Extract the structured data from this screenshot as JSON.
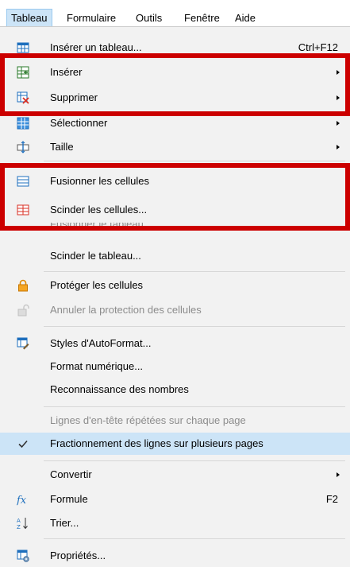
{
  "menubar": {
    "items": [
      {
        "label": "Tableau"
      },
      {
        "label": "Formulaire"
      },
      {
        "label": "Outils"
      },
      {
        "label": "Fenêtre"
      },
      {
        "label": "Aide"
      }
    ]
  },
  "menu": {
    "insert_table": {
      "label": "Insérer un tableau...",
      "shortcut": "Ctrl+F12"
    },
    "insert": {
      "label": "Insérer"
    },
    "delete": {
      "label": "Supprimer"
    },
    "select": {
      "label": "Sélectionner"
    },
    "size": {
      "label": "Taille"
    },
    "merge_cells": {
      "label": "Fusionner les cellules"
    },
    "split_cells": {
      "label": "Scinder les cellules..."
    },
    "merge_table": {
      "label": "Fusionner le tableau"
    },
    "split_table": {
      "label": "Scinder le tableau..."
    },
    "protect_cells": {
      "label": "Protéger les cellules"
    },
    "unprotect_cells": {
      "label": "Annuler la protection des cellules"
    },
    "autoformat": {
      "label": "Styles d'AutoFormat..."
    },
    "number_format": {
      "label": "Format numérique..."
    },
    "number_recognition": {
      "label": "Reconnaissance des nombres"
    },
    "repeat_heading": {
      "label": "Lignes d'en-tête répétées sur chaque page"
    },
    "row_break": {
      "label": "Fractionnement des lignes sur plusieurs pages"
    },
    "convert": {
      "label": "Convertir"
    },
    "formula": {
      "label": "Formule",
      "shortcut": "F2"
    },
    "sort": {
      "label": "Trier..."
    },
    "properties": {
      "label": "Propriétés..."
    }
  },
  "colors": {
    "highlight_box": "#cc0000",
    "menu_bg": "#f2f2f2",
    "checked_bg": "#cce4f7"
  }
}
